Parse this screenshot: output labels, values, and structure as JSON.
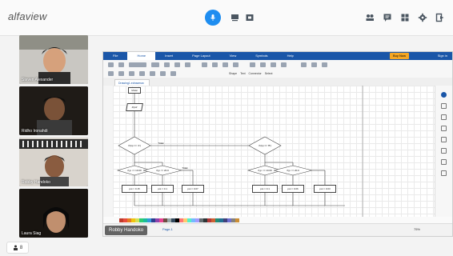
{
  "app": {
    "brand": "alfaview"
  },
  "topbar": {
    "center_icons": [
      "microphone-icon",
      "presentation-icon",
      "video-icon"
    ],
    "right_icons": [
      "people-icon",
      "chat-icon",
      "apps-icon",
      "gear-icon",
      "exit-icon"
    ]
  },
  "participants": [
    {
      "name": "Steven Alexander"
    },
    {
      "name": "Ridho Ironahdi"
    },
    {
      "name": "Robby Handoko"
    },
    {
      "name": "Laura Siag"
    }
  ],
  "participant_count": "8",
  "shared_screen": {
    "menu": [
      "File",
      "Home",
      "Insert",
      "Page Layout",
      "View",
      "Symbols",
      "Help"
    ],
    "active_menu": "Home",
    "buy_now": "Buy Now",
    "sign_in": "Sign in",
    "doc_tab": "Drawing1.edrawmax",
    "page_tab": "Page-1",
    "zoom": "75%",
    "presenter": "Robby Handoko",
    "toolbar_labels": [
      "Shape",
      "Text",
      "Connector",
      "Select"
    ],
    "flow_labels": {
      "start1": "Mulai",
      "input1": "Input",
      "cond_left": "if (kp == 'A')",
      "cond_right": "if (kp == 'B')",
      "yes": "Ya",
      "no": "Tidak",
      "cond_l1": "if jp <= 10.00",
      "cond_l2": "if jp <= 20.0",
      "cond_r1": "if jp <= 10.00",
      "cond_r2": "if jp <= 20.0",
      "box1": "pot = 0.15",
      "box2": "pot = 0.1",
      "box3": "pot = 0.07",
      "box4": "pot = 0.1",
      "box5": "pot = 0.06",
      "box6": "pot = 0.03"
    },
    "colors": {
      "menubar": "#1a56a8",
      "accent_button": "#f5a623",
      "mic_blue": "#1e8df0"
    }
  }
}
